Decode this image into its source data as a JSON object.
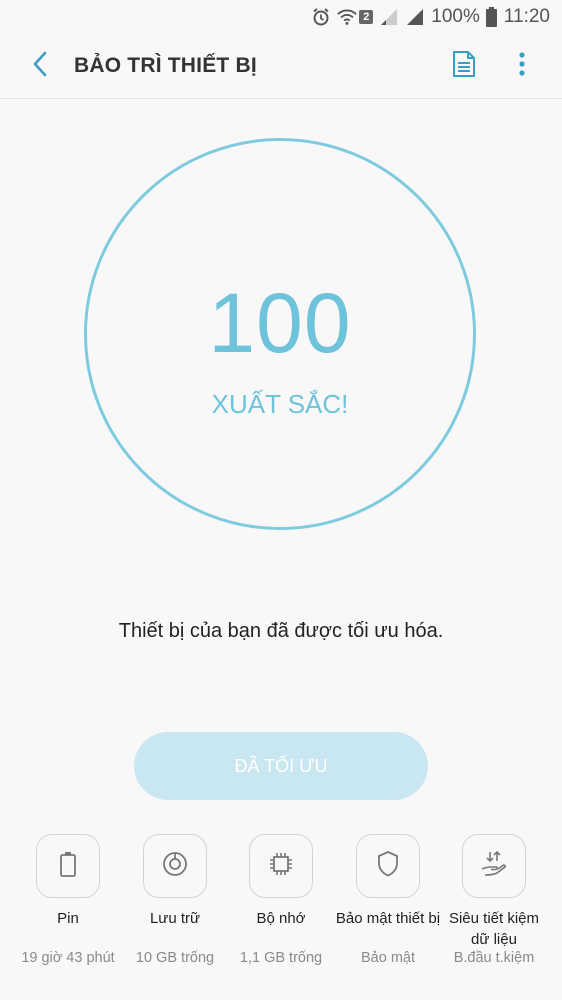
{
  "status_bar": {
    "battery": "100%",
    "time": "11:20",
    "sim": "2"
  },
  "app_bar": {
    "title": "BẢO TRÌ THIẾT BỊ"
  },
  "score": {
    "value": "100",
    "label": "XUẤT SẮC!"
  },
  "message": "Thiết bị của bạn đã được tối ưu hóa.",
  "optimize_button": "ĐÃ TỐI ƯU",
  "features": [
    {
      "label": "Pin",
      "sub": "19 giờ 43 phút",
      "icon": "battery-icon"
    },
    {
      "label": "Lưu trữ",
      "sub": "10 GB trống",
      "icon": "storage-icon"
    },
    {
      "label": "Bộ nhớ",
      "sub": "1,1 GB trống",
      "icon": "memory-chip-icon"
    },
    {
      "label": "Bảo mật thiết bị",
      "sub": "Bảo mật",
      "icon": "shield-icon"
    },
    {
      "label_line1": "Siêu tiết kiệm",
      "label_line2": "dữ liệu",
      "sub": "B.đầu t.kiệm",
      "icon": "data-saver-icon"
    }
  ],
  "colors": {
    "accent": "#6ec3db",
    "circle": "#7ecbdf",
    "button_bg": "#c9e7f0",
    "back_arrow": "#3a9fbf"
  }
}
